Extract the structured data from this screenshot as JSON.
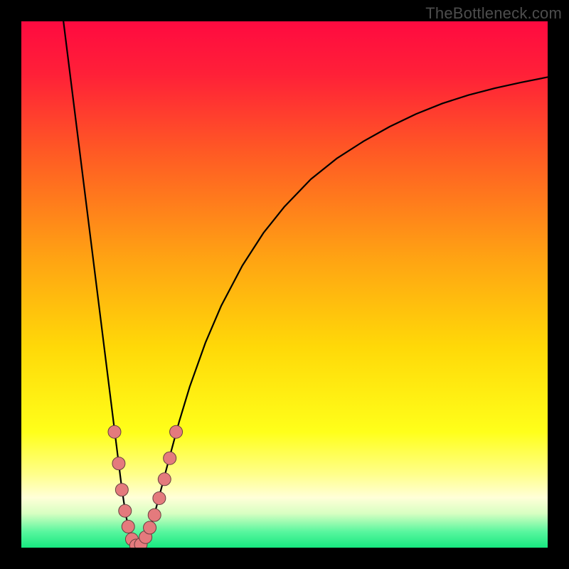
{
  "meta": {
    "watermark": "TheBottleneck.com"
  },
  "chart_data": {
    "type": "line",
    "title": "",
    "xlabel": "",
    "ylabel": "",
    "xlim": [
      0,
      100
    ],
    "ylim": [
      0,
      100
    ],
    "grid": false,
    "legend": false,
    "background": {
      "type": "vertical-gradient",
      "stops": [
        {
          "pos": 0.0,
          "color": "#ff0a40"
        },
        {
          "pos": 0.1,
          "color": "#ff2038"
        },
        {
          "pos": 0.25,
          "color": "#ff5a24"
        },
        {
          "pos": 0.45,
          "color": "#ffa313"
        },
        {
          "pos": 0.62,
          "color": "#ffd908"
        },
        {
          "pos": 0.78,
          "color": "#ffff1a"
        },
        {
          "pos": 0.86,
          "color": "#ffff8a"
        },
        {
          "pos": 0.905,
          "color": "#ffffd8"
        },
        {
          "pos": 0.935,
          "color": "#d8ffc2"
        },
        {
          "pos": 0.97,
          "color": "#58f69e"
        },
        {
          "pos": 1.0,
          "color": "#17e880"
        }
      ]
    },
    "series": [
      {
        "name": "bottleneck-curve",
        "color": "#000000",
        "x": [
          8.0,
          9.0,
          10.0,
          11.0,
          12.0,
          13.0,
          14.0,
          15.0,
          16.0,
          17.0,
          18.0,
          18.5,
          19.0,
          19.5,
          20.0,
          20.5,
          21.0,
          21.5,
          22.0,
          22.7,
          23.5,
          24.3,
          25.0,
          26.0,
          27.0,
          28.0,
          30.0,
          32.0,
          35.0,
          38.0,
          42.0,
          46.0,
          50.0,
          55.0,
          60.0,
          65.0,
          70.0,
          75.0,
          80.0,
          85.0,
          90.0,
          95.0,
          100.0
        ],
        "y": [
          100.0,
          92.0,
          84.0,
          76.0,
          68.0,
          60.0,
          52.0,
          44.0,
          36.0,
          28.0,
          20.0,
          16.0,
          12.0,
          8.5,
          5.5,
          3.2,
          1.6,
          0.6,
          0.1,
          0.3,
          1.4,
          3.2,
          5.3,
          9.0,
          12.8,
          16.6,
          24.0,
          30.6,
          39.0,
          46.0,
          53.6,
          59.8,
          64.8,
          70.0,
          74.0,
          77.2,
          80.0,
          82.4,
          84.4,
          86.0,
          87.3,
          88.4,
          89.4
        ]
      }
    ],
    "markers": {
      "name": "sample-points",
      "shape": "circle",
      "radius_px": 9,
      "fill": "#e47a7d",
      "stroke": "#663f3f",
      "points": [
        {
          "x": 17.7,
          "y": 22.0
        },
        {
          "x": 18.5,
          "y": 16.0
        },
        {
          "x": 19.1,
          "y": 11.0
        },
        {
          "x": 19.7,
          "y": 7.0
        },
        {
          "x": 20.3,
          "y": 4.0
        },
        {
          "x": 21.0,
          "y": 1.6
        },
        {
          "x": 21.8,
          "y": 0.4
        },
        {
          "x": 22.7,
          "y": 0.6
        },
        {
          "x": 23.6,
          "y": 2.0
        },
        {
          "x": 24.4,
          "y": 3.8
        },
        {
          "x": 25.3,
          "y": 6.2
        },
        {
          "x": 26.2,
          "y": 9.4
        },
        {
          "x": 27.2,
          "y": 13.0
        },
        {
          "x": 28.2,
          "y": 17.0
        },
        {
          "x": 29.4,
          "y": 22.0
        }
      ]
    }
  }
}
